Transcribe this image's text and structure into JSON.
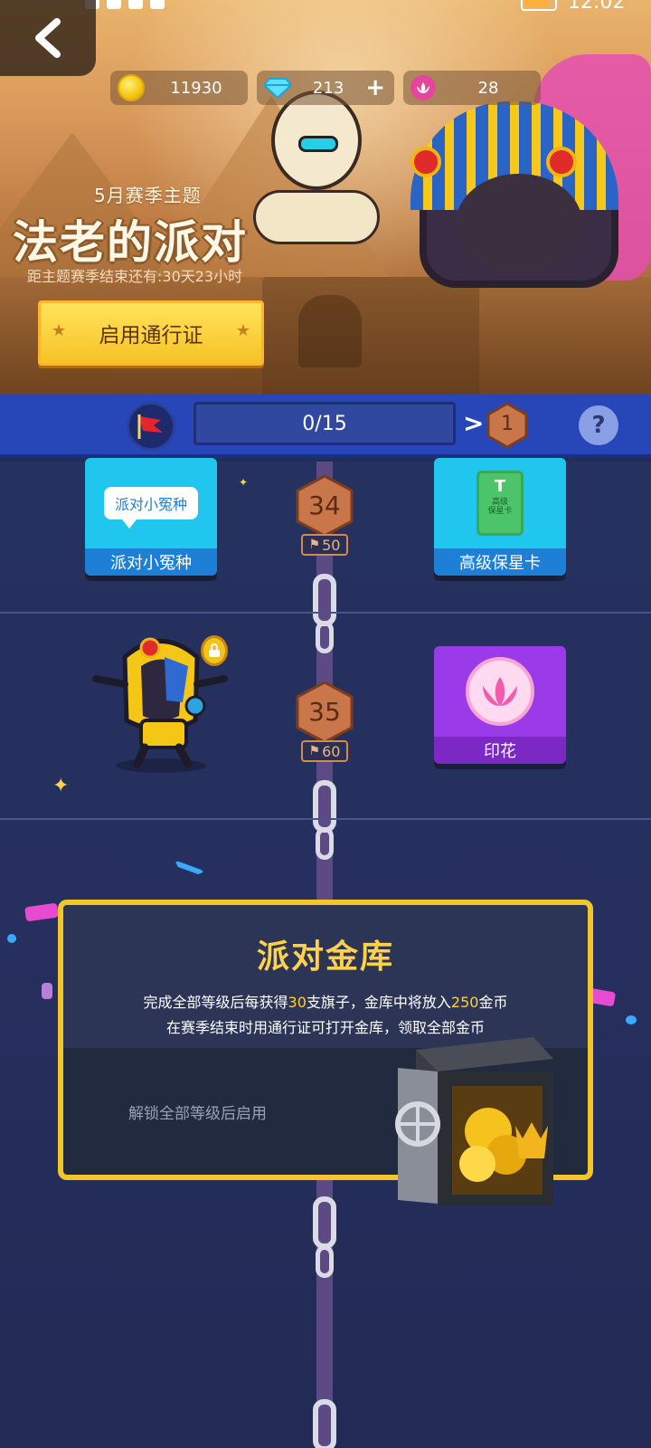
{
  "status_bar": {
    "time": "12:02"
  },
  "currency": {
    "coins": "11930",
    "gems": "213",
    "gems_add": "+",
    "stamps": "28"
  },
  "season": {
    "subtitle": "5月赛季主题",
    "title": "法老的派对",
    "countdown": "距主题赛季结束还有:30天23小时",
    "pass_button": "启用通行证"
  },
  "progress": {
    "text": "0/15",
    "arrow": ">",
    "next_level": "1",
    "help": "?"
  },
  "rewards": [
    {
      "level": "34",
      "flags": "50",
      "free_reward": {
        "label": "派对小冤种",
        "bubble": "派对小冤种"
      },
      "pass_reward": {
        "label": "高级保星卡",
        "card_symbol": "T",
        "card_text": "高级\n保星卡"
      }
    },
    {
      "level": "35",
      "flags": "60",
      "free_reward": {
        "label": "",
        "locked": true
      },
      "pass_reward": {
        "label": "印花"
      }
    }
  ],
  "vault": {
    "title": "派对金库",
    "line1_a": "完成全部等级后每获得",
    "line1_b": "30",
    "line1_c": "支旗子，金库中将放入",
    "line1_d": "250",
    "line1_e": "金币",
    "line2": "在赛季结束时用通行证可打开金库，领取全部金币",
    "locked_text": "解锁全部等级后启用"
  },
  "colors": {
    "accent_gold": "#f3c52a",
    "progress_blue": "#2747b8",
    "pass_button": "#ffe35b",
    "track_bg": "#25315f"
  }
}
